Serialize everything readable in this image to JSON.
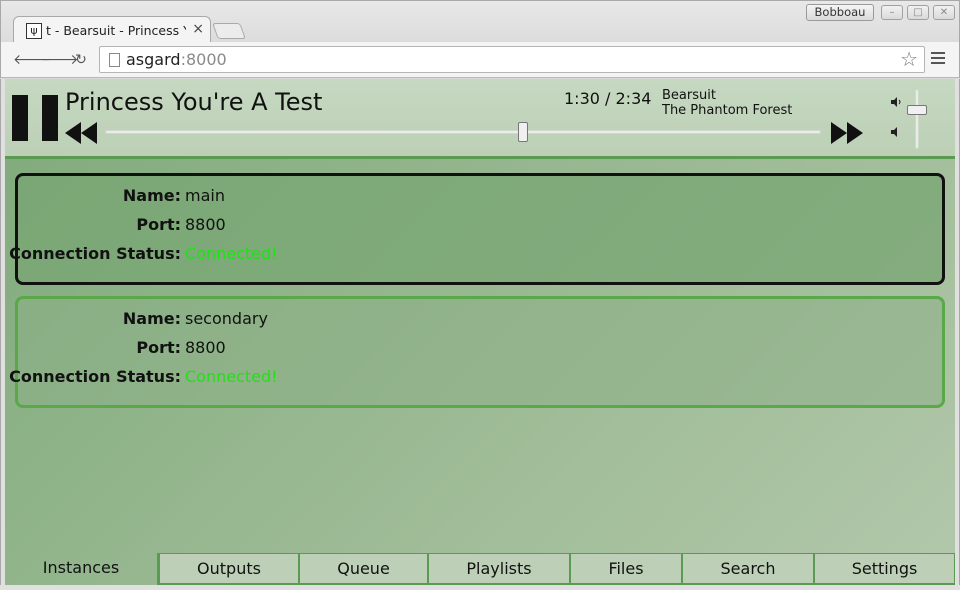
{
  "browser": {
    "tab_title": "t - Bearsuit - Princess Y",
    "tab_favicon": "ψ",
    "tab_close": "×",
    "profile_name": "Bobboau",
    "url_host": "asgard",
    "url_port": ":8000",
    "nav": {
      "back": "🡐",
      "forward": "🡒",
      "reload": "↻"
    },
    "star": "☆",
    "window": {
      "minimize": "–",
      "maximize": "□",
      "close": "✕"
    }
  },
  "player": {
    "title": "Princess You're A Test",
    "elapsed": "1:30",
    "duration": "2:34",
    "time_display": "1:30 / 2:34",
    "artist": "Bearsuit",
    "album": "The Phantom Forest",
    "progress_fraction": 0.584,
    "volume_fraction": 0.65
  },
  "instances": [
    {
      "name_label": "Name:",
      "name": "main",
      "port_label": "Port:",
      "port": "8800",
      "status_label": "Connection Status:",
      "status": "Connected!",
      "selected": true
    },
    {
      "name_label": "Name:",
      "name": "secondary",
      "port_label": "Port:",
      "port": "8800",
      "status_label": "Connection Status:",
      "status": "Connected!",
      "selected": false
    }
  ],
  "tabs": [
    {
      "label": "Instances",
      "active": true
    },
    {
      "label": "Outputs"
    },
    {
      "label": "Queue"
    },
    {
      "label": "Playlists"
    },
    {
      "label": "Files"
    },
    {
      "label": "Search"
    },
    {
      "label": "Settings"
    }
  ],
  "colors": {
    "accent_green": "#5b9a53",
    "status_ok": "#22e018",
    "selected_border": "#111111"
  }
}
